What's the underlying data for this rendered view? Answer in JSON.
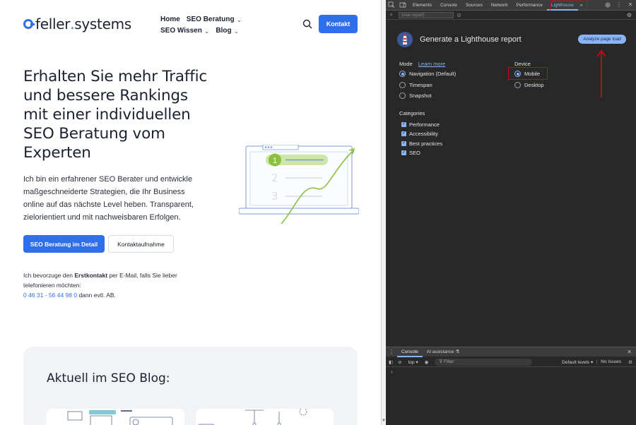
{
  "site": {
    "logo_pre": "feller",
    "logo_dot": ".",
    "logo_post": "systems",
    "nav": {
      "home": "Home",
      "seo_beratung": "SEO Beratung",
      "seo_wissen": "SEO Wissen",
      "blog": "Blog"
    },
    "kontakt_button": "Kontakt",
    "hero_title": "Erhalten Sie mehr Traffic und bessere Rankings mit einer individuellen SEO Beratung vom Experten",
    "hero_text": "Ich bin ein erfahrener SEO Berater und entwickle maßgeschneiderte Strategien, die Ihr Business online auf das nächste Level heben. Transparent, zielorientiert und mit nachweisbaren Erfolgen.",
    "cta_primary": "SEO Beratung im Detail",
    "cta_secondary": "Kontaktaufnahme",
    "contact_pre": "Ich bevorzuge den ",
    "contact_bold": "Erstkontakt",
    "contact_post": " per E-Mail, falls Sie lieber telefonieren möchten:",
    "phone": "0 46 31 - 56 44 98 0",
    "phone_suffix": " dann evtl. AB.",
    "illustration_numbers": [
      "1",
      "2",
      "3"
    ],
    "blog_title": "Aktuell im SEO Blog:"
  },
  "devtools": {
    "tabs": [
      "Elements",
      "Console",
      "Sources",
      "Network",
      "Performance",
      "Lighthouse"
    ],
    "active_tab": "Lighthouse",
    "more_tabs": "»",
    "report_select": "(new report)",
    "lighthouse": {
      "title": "Generate a Lighthouse report",
      "analyze_button": "Analyze page load",
      "mode_label": "Mode",
      "learn_more": "Learn more",
      "modes": [
        "Navigation (Default)",
        "Timespan",
        "Snapshot"
      ],
      "device_label": "Device",
      "devices": [
        "Mobile",
        "Desktop"
      ],
      "categories_label": "Categories",
      "categories": [
        "Performance",
        "Accessibility",
        "Best practices",
        "SEO"
      ]
    },
    "drawer": {
      "tabs": [
        "Console",
        "AI assistance"
      ],
      "context": "top",
      "filter_placeholder": "Filter",
      "default_levels": "Default levels",
      "no_issues": "No Issues",
      "prompt": "›"
    },
    "colors": {
      "accent": "#8ab4f8",
      "highlight": "#d4001a",
      "site_blue": "#2f6fea"
    }
  }
}
